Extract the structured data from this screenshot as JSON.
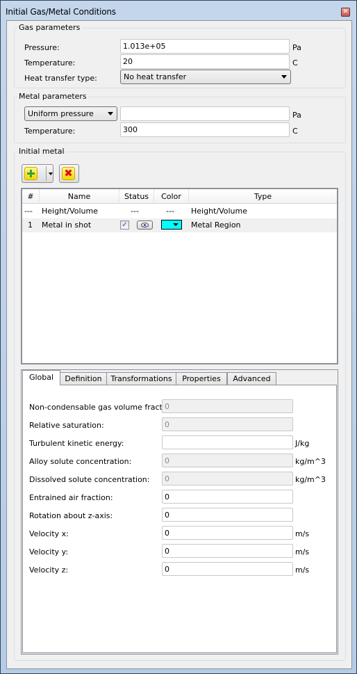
{
  "window": {
    "title": "Initial Gas/Metal Conditions",
    "close_icon": "close-icon"
  },
  "gas": {
    "group_label": "Gas parameters",
    "pressure_label": "Pressure:",
    "pressure_value": "1.013e+05",
    "pressure_unit": "Pa",
    "temperature_label": "Temperature:",
    "temperature_value": "20",
    "temperature_unit": "C",
    "heat_transfer_label": "Heat transfer type:",
    "heat_transfer_value": "No heat transfer"
  },
  "metal": {
    "group_label": "Metal parameters",
    "pressure_mode": "Uniform pressure",
    "pressure_value": "",
    "pressure_unit": "Pa",
    "temperature_label": "Temperature:",
    "temperature_value": "300",
    "temperature_unit": "C"
  },
  "initial_metal": {
    "group_label": "Initial metal",
    "add_icon": "plus-icon",
    "delete_icon": "delete-x-icon",
    "columns": [
      "#",
      "Name",
      "Status",
      "Color",
      "Type"
    ],
    "rows": [
      {
        "index": "---",
        "name": "Height/Volume",
        "status": "---",
        "color": "---",
        "type": "Height/Volume"
      },
      {
        "index": "1",
        "name": "Metal in shot",
        "status_checked": true,
        "color_hex": "#00ffff",
        "type": "Metal Region"
      }
    ]
  },
  "tabs": [
    {
      "label": "Global",
      "active": true
    },
    {
      "label": "Definition",
      "active": false
    },
    {
      "label": "Transformations",
      "active": false
    },
    {
      "label": "Properties",
      "active": false
    },
    {
      "label": "Advanced",
      "active": false
    }
  ],
  "global": {
    "fields": [
      {
        "label": "Non-condensable gas volume fraction:",
        "value": "0",
        "unit": "",
        "disabled": true
      },
      {
        "label": "Relative saturation:",
        "value": "0",
        "unit": "",
        "disabled": true
      },
      {
        "label": "Turbulent kinetic energy:",
        "value": "",
        "unit": "J/kg",
        "disabled": false
      },
      {
        "label": "Alloy solute concentration:",
        "value": "0",
        "unit": "kg/m^3",
        "disabled": true
      },
      {
        "label": "Dissolved solute concentration:",
        "value": "0",
        "unit": "kg/m^3",
        "disabled": true
      },
      {
        "label": "Entrained air fraction:",
        "value": "0",
        "unit": "",
        "disabled": false
      },
      {
        "label": "Rotation about z-axis:",
        "value": "0",
        "unit": "",
        "disabled": false
      },
      {
        "label": "Velocity x:",
        "value": "0",
        "unit": "m/s",
        "disabled": false
      },
      {
        "label": "Velocity y:",
        "value": "0",
        "unit": "m/s",
        "disabled": false
      },
      {
        "label": "Velocity z:",
        "value": "0",
        "unit": "m/s",
        "disabled": false
      }
    ]
  }
}
